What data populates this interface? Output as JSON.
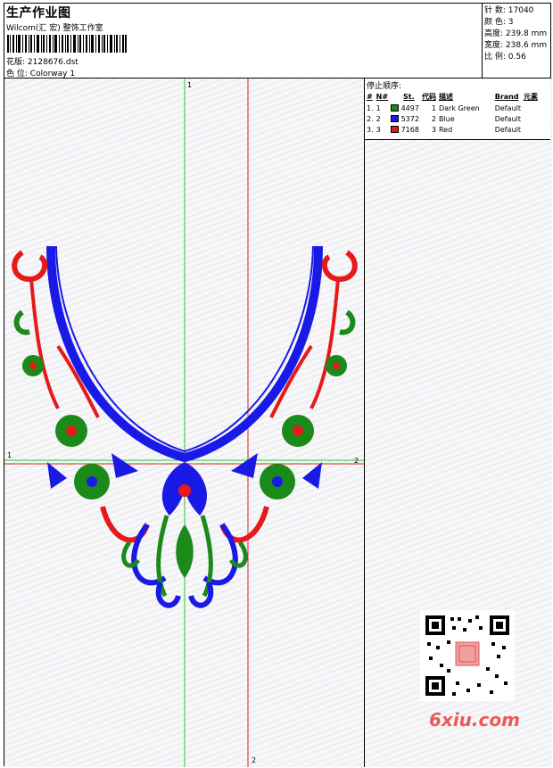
{
  "header": {
    "title": "生产作业图",
    "subtitle": "Wilcom(汇 宏) 整饰工作室",
    "design_label": "花版:",
    "design_file": "2128676.dst",
    "colorway_label": "色 位:",
    "colorway": "Colorway 1"
  },
  "stats": [
    {
      "label": "针 数:",
      "value": "17040"
    },
    {
      "label": "颜 色:",
      "value": "3"
    },
    {
      "label": "高度:",
      "value": "239.8 mm"
    },
    {
      "label": "宽度:",
      "value": "238.6 mm"
    },
    {
      "label": "比 例:",
      "value": "0.56"
    }
  ],
  "stop_sequence": {
    "title": "停止顺序:",
    "columns": [
      "#",
      "N#",
      "St.",
      "代码",
      "描述",
      "Brand",
      "元素"
    ],
    "rows": [
      {
        "num": "1.",
        "n": "1",
        "stitches": "4497",
        "code": "1",
        "desc": "Dark Green",
        "brand": "Default",
        "color": "#1a8a1a"
      },
      {
        "num": "2.",
        "n": "2",
        "stitches": "5372",
        "code": "2",
        "desc": "Blue",
        "brand": "Default",
        "color": "#1a1ae6"
      },
      {
        "num": "3.",
        "n": "3",
        "stitches": "7168",
        "code": "3",
        "desc": "Red",
        "brand": "Default",
        "color": "#e61a1a"
      }
    ]
  },
  "guides": {
    "top": "1",
    "bottom": "2",
    "left": "1",
    "right": "2"
  },
  "colors": {
    "green": "#1a8a1a",
    "blue": "#1a1ae6",
    "red": "#e61a1a"
  },
  "watermark": "6xiu.com"
}
